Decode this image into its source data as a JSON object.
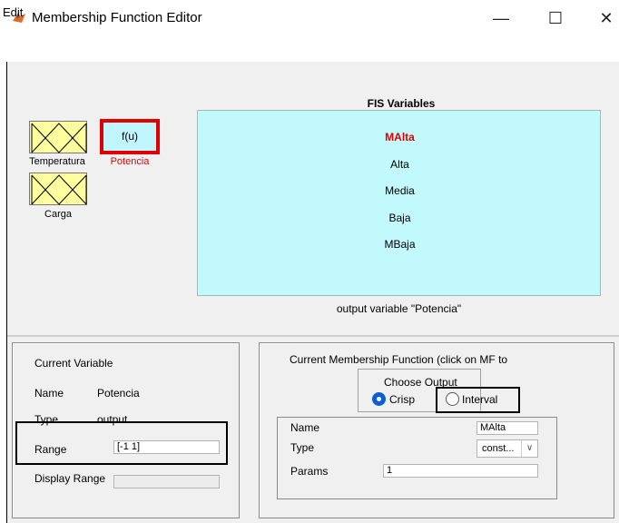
{
  "window": {
    "title": "Membership Function Editor",
    "minimize_glyph": "—",
    "maximize_glyph": "☐",
    "close_glyph": "✕"
  },
  "menu": {
    "items": [
      "Edit"
    ]
  },
  "fis_diagram": {
    "inputs": [
      {
        "name": "Temperatura",
        "icon": "membership-triangles-icon"
      },
      {
        "name": "Carga",
        "icon": "membership-triangles-icon"
      }
    ],
    "output": {
      "symbol": "f(u)",
      "name": "Potencia"
    }
  },
  "fis_variables": {
    "title": "FIS Variables",
    "mfs": [
      "MAlta",
      "Alta",
      "Media",
      "Baja",
      "MBaja"
    ],
    "selected_index": 0,
    "caption": "output variable \"Potencia\""
  },
  "current_variable": {
    "title": "Current Variable",
    "name_label": "Name",
    "name_value": "Potencia",
    "type_label": "Type",
    "type_value": "output",
    "range_label": "Range",
    "range_value": "[-1 1]",
    "display_range_label": "Display Range",
    "display_range_value": ""
  },
  "current_mf": {
    "title": "Current Membership Function (click on MF to",
    "choose_output_label": "Choose Output",
    "crisp_label": "Crisp",
    "interval_label": "Interval",
    "selected_output": "Crisp",
    "name_label": "Name",
    "name_value": "MAlta",
    "type_label": "Type",
    "type_value": "const...",
    "params_label": "Params",
    "params_value": "1"
  },
  "colors": {
    "selected": "#e10000",
    "fis_panel_bg": "#c2f9fc",
    "input_box_bg": "#fffe9e",
    "radio_selected": "#0b5fd0"
  }
}
